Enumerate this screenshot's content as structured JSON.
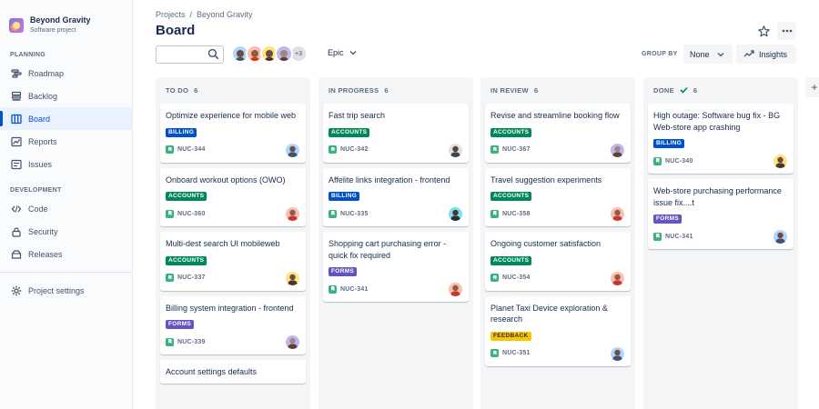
{
  "project": {
    "name": "Beyond Gravity",
    "type": "Software project"
  },
  "sidebar": {
    "planning_label": "PLANNING",
    "development_label": "DEVELOPMENT",
    "planning": [
      {
        "label": "Roadmap",
        "icon": "roadmap-icon"
      },
      {
        "label": "Backlog",
        "icon": "backlog-icon"
      },
      {
        "label": "Board",
        "icon": "board-icon",
        "active": true
      },
      {
        "label": "Reports",
        "icon": "reports-icon"
      },
      {
        "label": "Issues",
        "icon": "issues-icon"
      }
    ],
    "development": [
      {
        "label": "Code",
        "icon": "code-icon"
      },
      {
        "label": "Security",
        "icon": "lock-icon"
      },
      {
        "label": "Releases",
        "icon": "releases-icon"
      }
    ],
    "settings": {
      "label": "Project settings",
      "icon": "gear-icon"
    }
  },
  "header": {
    "breadcrumb": [
      "Projects",
      "Beyond Gravity"
    ],
    "breadcrumb_sep": "/",
    "title": "Board"
  },
  "toolbar": {
    "search_placeholder": "",
    "avatars_more": "+3",
    "epic_label": "Epic",
    "group_by_label": "GROUP BY",
    "group_by_value": "None",
    "insights_label": "Insights"
  },
  "colors": {
    "BILLING": "#0052cc",
    "ACCOUNTS": "#00875a",
    "FORMS": "#6554c0",
    "FEEDBACK": "#ffc400"
  },
  "columns": [
    {
      "name": "TO DO",
      "count": "6",
      "done": false,
      "cards": [
        {
          "title": "Optimize experience for mobile web",
          "tag": "BILLING",
          "key": "NUC-344",
          "avatar": "a"
        },
        {
          "title": "Onboard workout options (OWO)",
          "tag": "ACCOUNTS",
          "key": "NUC-360",
          "avatar": "b"
        },
        {
          "title": "Multi-dest search UI mobileweb",
          "tag": "ACCOUNTS",
          "key": "NUC-337",
          "avatar": "c"
        },
        {
          "title": "Billing system integration - frontend",
          "tag": "FORMS",
          "key": "NUC-339",
          "avatar": "d"
        },
        {
          "title": "Account settings defaults",
          "tag": "",
          "key": "",
          "avatar": ""
        }
      ]
    },
    {
      "name": "IN PROGRESS",
      "count": "6",
      "done": false,
      "cards": [
        {
          "title": "Fast trip search",
          "tag": "ACCOUNTS",
          "key": "NUC-342",
          "avatar": "e"
        },
        {
          "title": "Affelite links integration - frontend",
          "tag": "BILLING",
          "key": "NUC-335",
          "avatar": "f"
        },
        {
          "title": "Shopping cart purchasing error - quick fix required",
          "tag": "FORMS",
          "key": "NUC-341",
          "avatar": "b"
        }
      ]
    },
    {
      "name": "IN REVIEW",
      "count": "6",
      "done": false,
      "cards": [
        {
          "title": "Revise and streamline booking flow",
          "tag": "ACCOUNTS",
          "key": "NUC-367",
          "avatar": "d"
        },
        {
          "title": "Travel suggestion experiments",
          "tag": "ACCOUNTS",
          "key": "NUC-358",
          "avatar": "b"
        },
        {
          "title": "Ongoing customer satisfaction",
          "tag": "ACCOUNTS",
          "key": "NUC-354",
          "avatar": "b"
        },
        {
          "title": "Planet Taxi Device exploration & research",
          "tag": "FEEDBACK",
          "key": "NUC-351",
          "avatar": "a"
        }
      ]
    },
    {
      "name": "DONE",
      "count": "6",
      "done": true,
      "cards": [
        {
          "title": "High outage: Software bug fix - BG Web-store app crashing",
          "tag": "BILLING",
          "key": "NUC-340",
          "avatar": "c"
        },
        {
          "title": "Web-store purchasing performance issue fix....t",
          "tag": "FORMS",
          "key": "NUC-341",
          "avatar": "a"
        }
      ]
    }
  ],
  "add_column_label": "+"
}
